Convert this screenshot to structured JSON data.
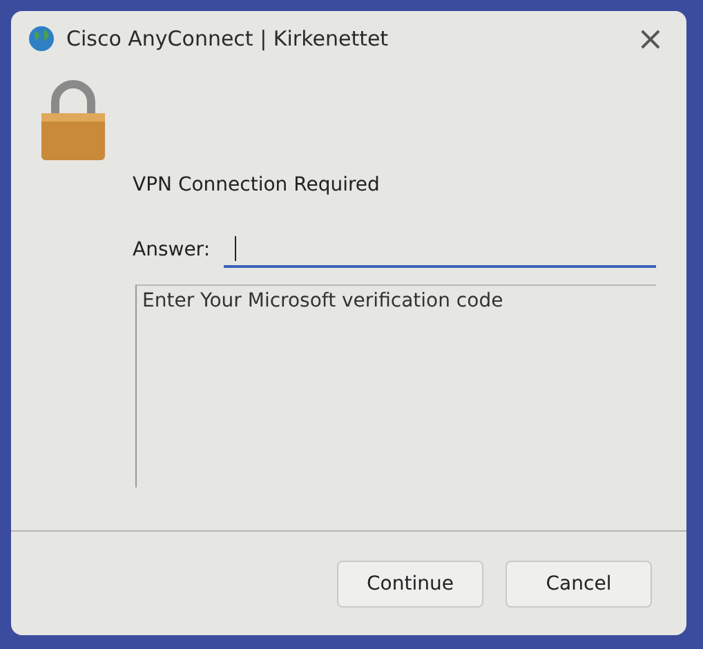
{
  "window": {
    "title": "Cisco AnyConnect | Kirkenettet",
    "close": "×"
  },
  "prompt": "VPN Connection Required",
  "answer": {
    "label": "Answer:",
    "focused": true
  },
  "message": "Enter Your Microsoft verification code",
  "buttons": [
    "Continue",
    "Cancel"
  ]
}
